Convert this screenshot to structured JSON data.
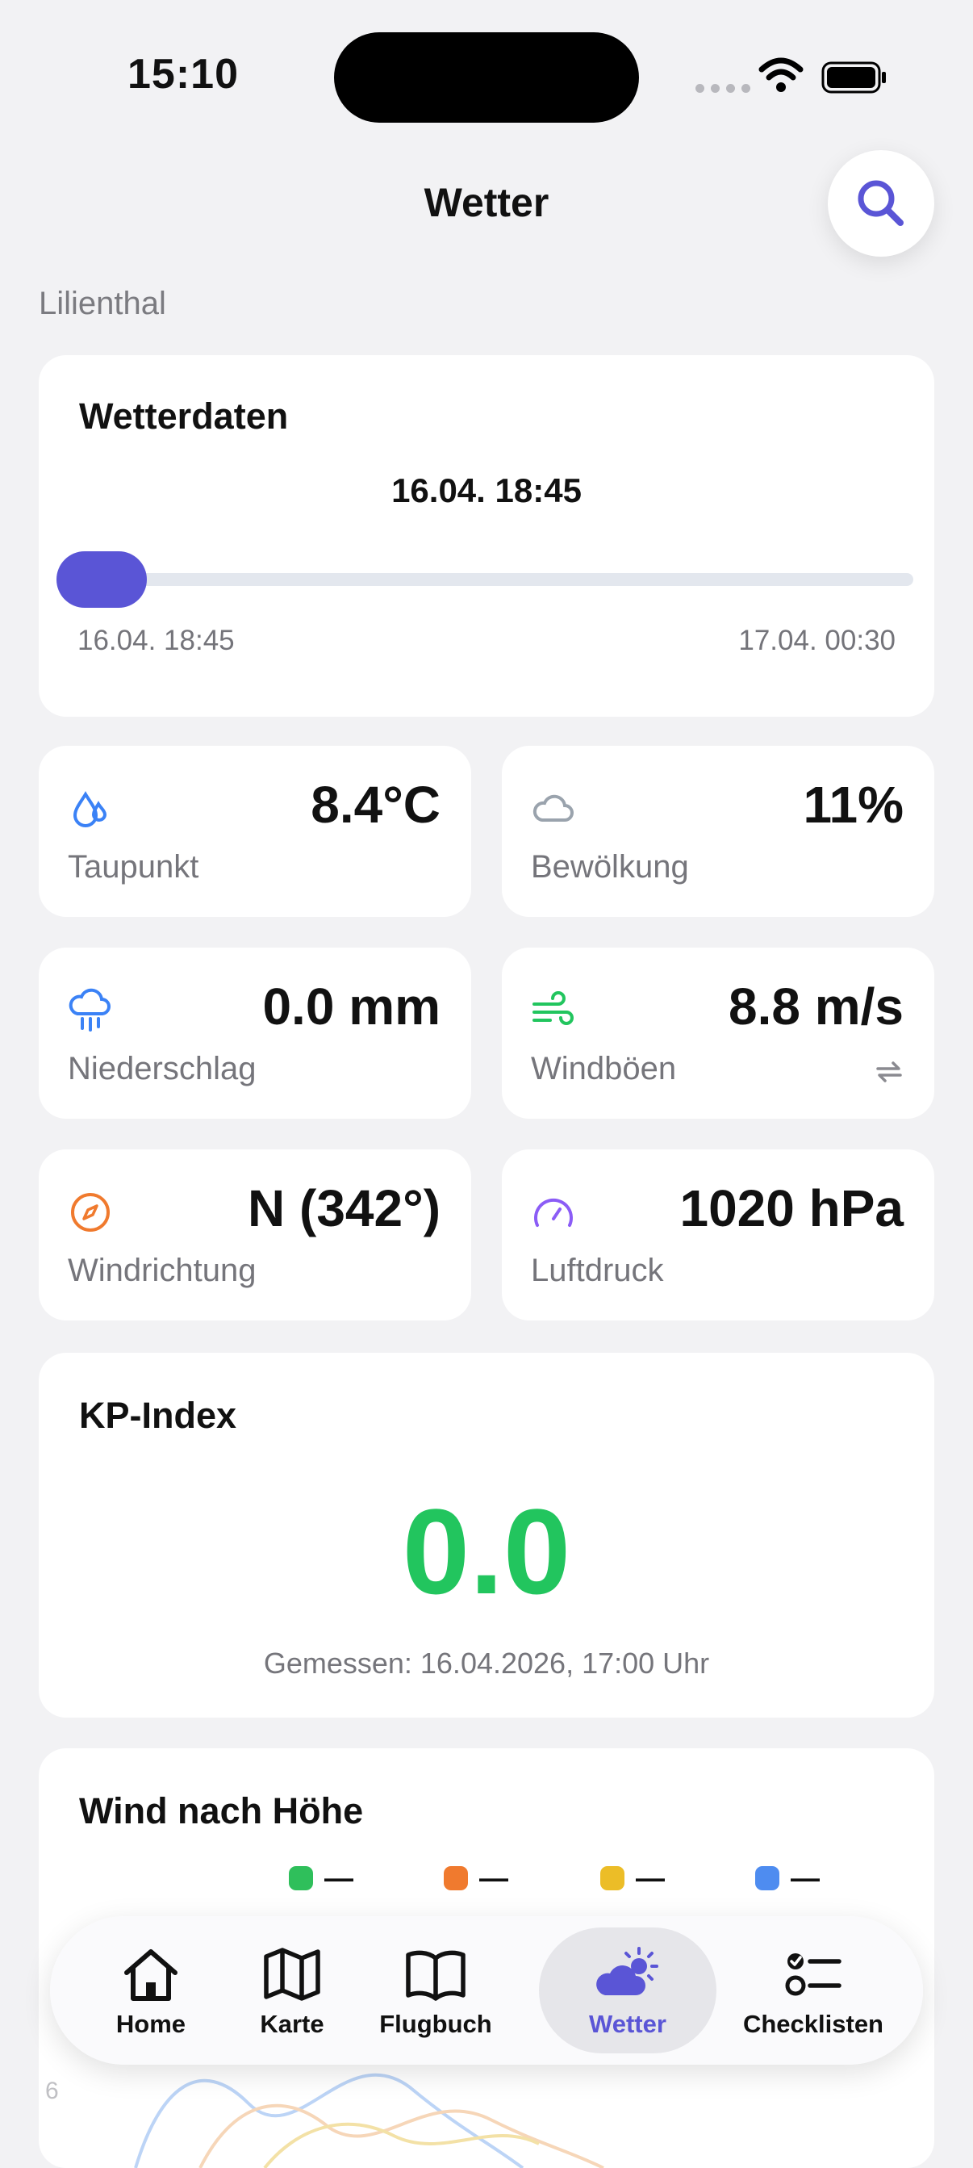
{
  "status_bar": {
    "time": "15:10"
  },
  "header": {
    "title": "Wetter",
    "location": "Lilienthal"
  },
  "weather_data": {
    "title": "Wetterdaten",
    "selected_time": "16.04. 18:45",
    "range_start": "16.04. 18:45",
    "range_end": "17.04. 00:30",
    "slider_position": 0
  },
  "metrics": {
    "dewpoint": {
      "value": "8.4°C",
      "label": "Taupunkt",
      "icon": "droplets-icon"
    },
    "cloud": {
      "value": "11%",
      "label": "Bewölkung",
      "icon": "cloud-icon"
    },
    "precip": {
      "value": "0.0 mm",
      "label": "Niederschlag",
      "icon": "cloud-rain-icon"
    },
    "gusts": {
      "value": "8.8 m/s",
      "label": "Windböen",
      "icon": "wind-icon"
    },
    "direction": {
      "value": "N (342°)",
      "label": "Windrichtung",
      "icon": "compass-icon"
    },
    "pressure": {
      "value": "1020 hPa",
      "label": "Luftdruck",
      "icon": "gauge-icon"
    }
  },
  "kp_index": {
    "title": "KP-Index",
    "value": "0.0",
    "measured": "Gemessen: 16.04.2026, 17:00 Uhr"
  },
  "wind_by_height": {
    "title": "Wind nach Höhe",
    "legend": [
      {
        "value": "—",
        "color": "#2fbf5b"
      },
      {
        "value": "—",
        "color": "#f07a2e"
      },
      {
        "value": "—",
        "color": "#ecbd27"
      },
      {
        "value": "—",
        "color": "#4e8cf0"
      }
    ],
    "axis_tick": "6"
  },
  "tabs": [
    {
      "label": "Home",
      "icon": "home-icon"
    },
    {
      "label": "Karte",
      "icon": "map-icon"
    },
    {
      "label": "Flugbuch",
      "icon": "book-icon"
    },
    {
      "label": "Wetter",
      "icon": "cloud-sun-icon",
      "active": true
    },
    {
      "label": "Checklisten",
      "icon": "checklist-icon"
    }
  ],
  "colors": {
    "accent": "#5a55d6",
    "kp_green": "#22c55e",
    "background": "#f2f2f4"
  }
}
